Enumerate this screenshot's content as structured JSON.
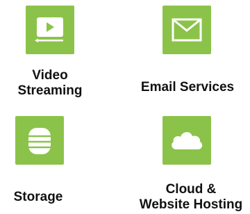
{
  "colors": {
    "tile": "#8bc34a",
    "icon": "#ffffff",
    "text": "#111111"
  },
  "services": [
    {
      "icon": "video-player-icon",
      "label_lines": [
        "Video",
        "Streaming"
      ]
    },
    {
      "icon": "envelope-icon",
      "label_lines": [
        "Email Services"
      ]
    },
    {
      "icon": "database-icon",
      "label_lines": [
        "Storage"
      ]
    },
    {
      "icon": "cloud-icon",
      "label_lines": [
        "Cloud &",
        "Website Hosting"
      ]
    }
  ]
}
